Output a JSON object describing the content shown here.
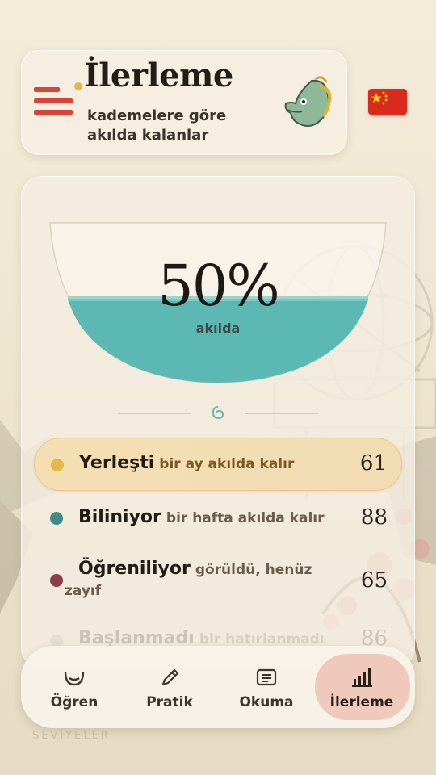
{
  "header": {
    "title": "İlerleme",
    "subtitle": "kademelere göre akılda kalanlar",
    "mascot_icon": "dragon-mascot-icon",
    "menu_icon": "menu-icon"
  },
  "language_flag": {
    "icon": "china-flag-icon",
    "colors": {
      "field": "#d92a1e",
      "stars": "#ffde00"
    }
  },
  "progress": {
    "value": "50%",
    "label": "akılda",
    "fill_fraction": 0.5,
    "water_color": "#5cb8b2"
  },
  "stages": [
    {
      "name": "Yerleşti",
      "desc": "bir ay akılda kalır",
      "count": "61",
      "color": "#e3b94b",
      "highlighted": true
    },
    {
      "name": "Biliniyor",
      "desc": "bir hafta akılda kalır",
      "count": "88",
      "color": "#3e8a86"
    },
    {
      "name": "Öğreniliyor",
      "desc": "görüldü, henüz",
      "desc2": "zayıf",
      "count": "65",
      "color": "#8e3c4a"
    },
    {
      "name": "Başlanmadı",
      "desc": "bir hatırlanmadı",
      "count": "86",
      "color": "#b0a79a"
    }
  ],
  "nav": [
    {
      "label": "Öğren",
      "icon": "learn-icon"
    },
    {
      "label": "Pratik",
      "icon": "pencil-icon"
    },
    {
      "label": "Okuma",
      "icon": "reading-icon"
    },
    {
      "label": "İlerleme",
      "icon": "bar-chart-icon",
      "active": true
    }
  ],
  "footer_ghost": "SEVİYELER"
}
